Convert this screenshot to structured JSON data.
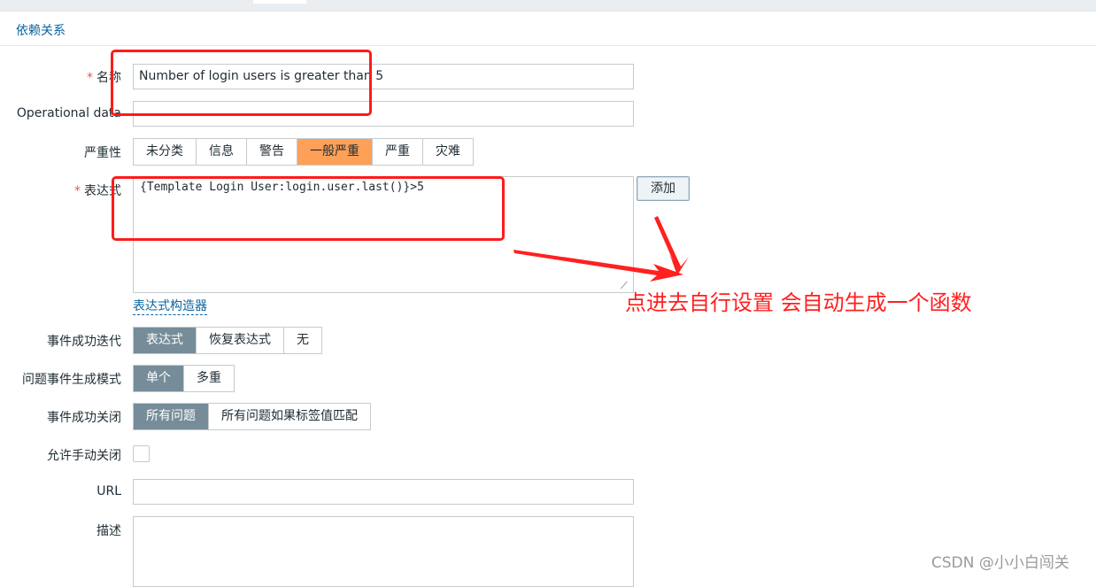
{
  "tab": {
    "label": "依赖关系"
  },
  "form": {
    "required_mark": "*",
    "name": {
      "label": "名称",
      "value": "Number of login users is greater than 5"
    },
    "operational_data": {
      "label": "Operational data",
      "value": ""
    },
    "severity": {
      "label": "严重性",
      "options": [
        "未分类",
        "信息",
        "警告",
        "一般严重",
        "严重",
        "灾难"
      ],
      "selected": "一般严重"
    },
    "expression": {
      "label": "表达式",
      "value": "{Template Login User:login.user.last()}>5",
      "add_button": "添加",
      "builder_link": "表达式构造器"
    },
    "ok_event_generation": {
      "label": "事件成功迭代",
      "options": [
        "表达式",
        "恢复表达式",
        "无"
      ],
      "selected": "表达式"
    },
    "problem_event_mode": {
      "label": "问题事件生成模式",
      "options": [
        "单个",
        "多重"
      ],
      "selected": "单个"
    },
    "ok_event_closes": {
      "label": "事件成功关闭",
      "options": [
        "所有问题",
        "所有问题如果标签值匹配"
      ],
      "selected": "所有问题"
    },
    "allow_manual_close": {
      "label": "允许手动关闭",
      "checked": false
    },
    "url": {
      "label": "URL",
      "value": ""
    },
    "description": {
      "label": "描述",
      "value": ""
    }
  },
  "annotation": {
    "text": "点进去自行设置  会自动生成一个函数",
    "color": "#ff2020"
  },
  "watermark": {
    "text": "CSDN @小小白闯关"
  },
  "colors": {
    "selected_gray": "#768d99",
    "selected_orange": "#ffa059",
    "link": "#0a64a0"
  }
}
